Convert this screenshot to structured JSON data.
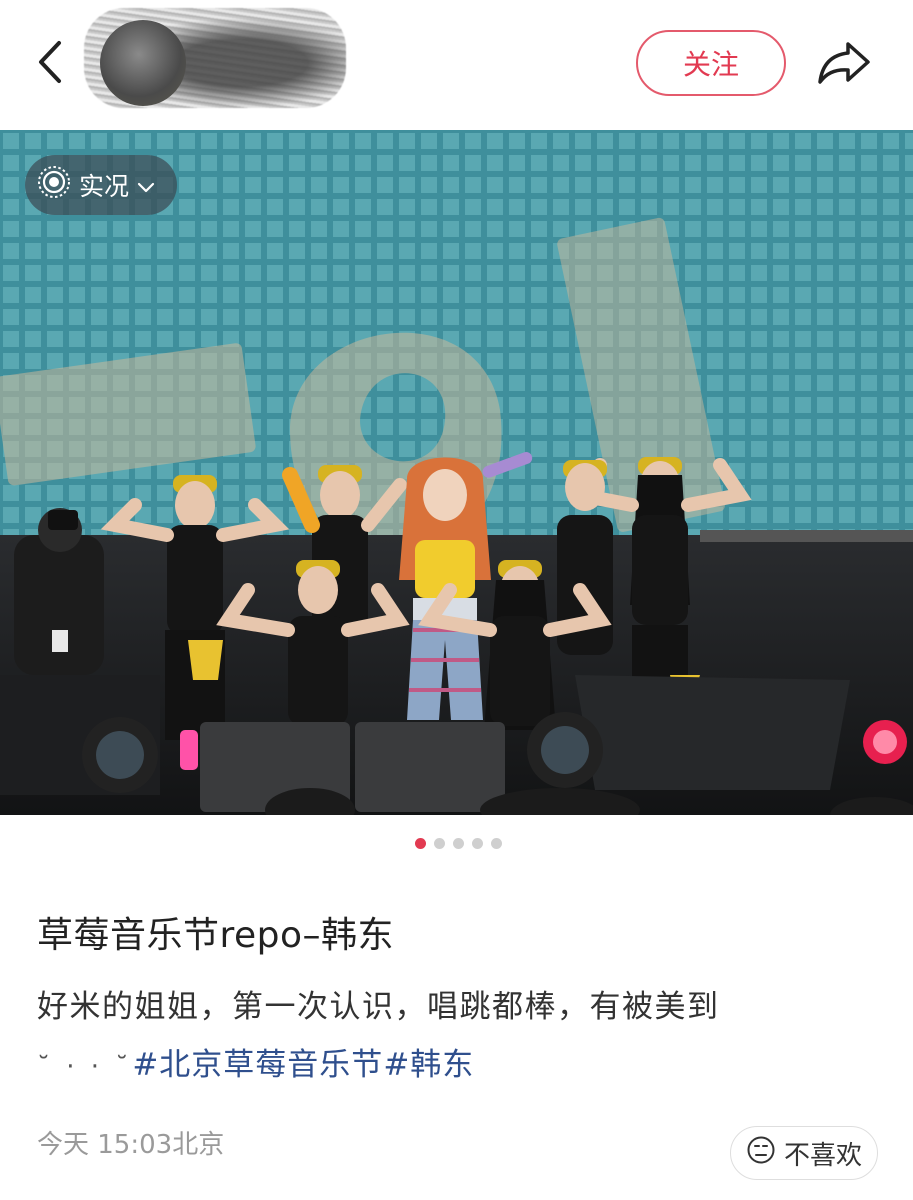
{
  "header": {
    "follow_label": "关注"
  },
  "photo": {
    "live_badge_label": "实况",
    "page_count": 5,
    "active_page": 1
  },
  "post": {
    "title": "草莓音乐节repo–韩东",
    "body_text": "好米的姐姐，第一次认识，唱跳都棒，有被美到",
    "emoji_text": "˘ · · ˘",
    "tags": [
      "#北京草莓音乐节",
      "#韩东"
    ]
  },
  "meta": {
    "time_location": "今天 15:03北京",
    "dislike_label": "不喜欢"
  },
  "icons": {
    "back": "chevron-left-icon",
    "share": "share-arrow-icon",
    "live": "live-photo-icon",
    "dropdown": "chevron-down-icon",
    "dislike": "frown-face-icon"
  },
  "colors": {
    "accent": "#e23a51",
    "tag": "#2f4f8d",
    "meta": "#9a9a9a"
  }
}
